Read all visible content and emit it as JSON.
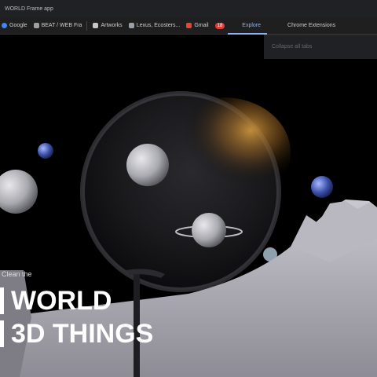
{
  "window": {
    "title": "WORLD Frame app"
  },
  "bookmarks": [
    {
      "label": "Google",
      "icon": "google-icon",
      "color": "#4285f4"
    },
    {
      "label": "BEAT / WEB Fra",
      "icon": "page-icon",
      "color": "#9aa0a6"
    },
    {
      "label": "Artworks",
      "icon": "bookmark-icon",
      "color": "#9aa0a6"
    },
    {
      "label": "Lexus, Ecosters...",
      "icon": "page-icon",
      "color": "#9aa0a6"
    },
    {
      "label": "Gmail",
      "icon": "mail-icon",
      "color": "#ea4335"
    }
  ],
  "badge": {
    "count": "18",
    "color": "#e53935"
  },
  "tabs_right": [
    {
      "label": "Explore"
    },
    {
      "label": "Chrome Extensions"
    }
  ],
  "dropdown": {
    "item": "Collapse all tabs"
  },
  "hero": {
    "kicker": "Clean the",
    "line1": "WORLD",
    "line2": "3D THINGS"
  },
  "colors": {
    "accent": "#8ab4f8",
    "background": "#000000",
    "ground": "#a9a7b0"
  }
}
